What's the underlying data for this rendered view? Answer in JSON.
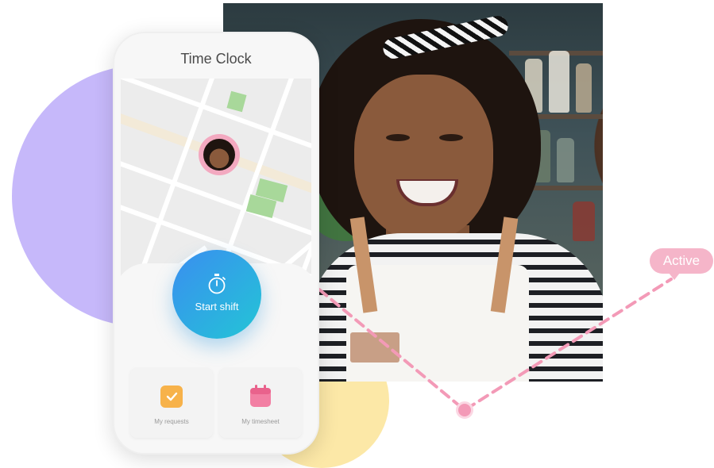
{
  "phone": {
    "title": "Time Clock",
    "start_shift_label": "Start shift",
    "cards": [
      {
        "label": "My requests",
        "icon": "checkmark-icon",
        "color": "#f7b24a"
      },
      {
        "label": "My timesheet",
        "icon": "calendar-icon",
        "color": "#f27fa3"
      }
    ]
  },
  "status": {
    "label": "Active",
    "color": "#f5b5c9"
  },
  "colors": {
    "accent_gradient_start": "#3a8ef0",
    "accent_gradient_end": "#23c5d6",
    "purple_blob": "#c6b8fa",
    "yellow_blob": "#fce8a7",
    "connector": "#f39ab7"
  }
}
